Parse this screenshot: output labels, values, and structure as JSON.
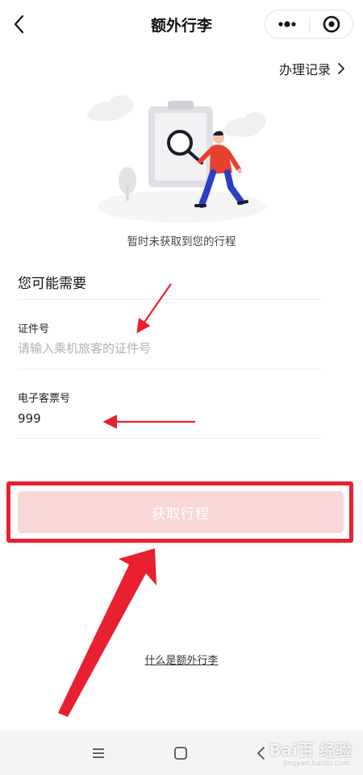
{
  "header": {
    "title": "额外行李"
  },
  "record_link": {
    "label": "办理记录"
  },
  "empty_state": {
    "text": "暂时未获取到您的行程"
  },
  "section": {
    "title": "您可能需要"
  },
  "fields": {
    "id_number": {
      "label": "证件号",
      "placeholder": "请输入乘机旅客的证件号",
      "value": ""
    },
    "ticket_number": {
      "label": "电子客票号",
      "value": "999"
    }
  },
  "submit": {
    "label": "获取行程"
  },
  "help_link": {
    "label": "什么是额外行李"
  },
  "colors": {
    "accent": "#e8202f",
    "button_disabled": "#f9d6d8",
    "figure_jacket": "#e8402f",
    "figure_pants": "#2a3ec6"
  },
  "watermark": {
    "brand": "Bai百 经验",
    "sub": "jingyan.baidu.com"
  }
}
